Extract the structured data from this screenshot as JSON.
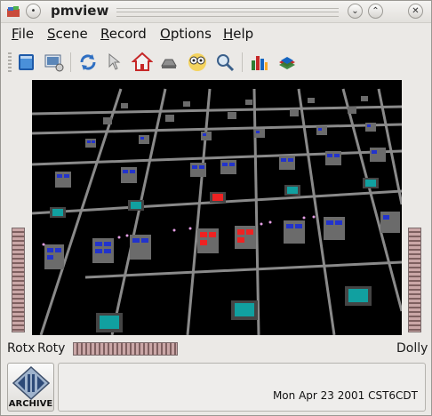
{
  "window": {
    "title": "pmview"
  },
  "titlebar_buttons": {
    "menu_glyph": "•",
    "minimize_glyph": "⌄",
    "maximize_glyph": "⌃",
    "close_glyph": "✕"
  },
  "menu": {
    "items": [
      {
        "accel": "F",
        "rest": "ile"
      },
      {
        "accel": "S",
        "rest": "cene"
      },
      {
        "accel": "R",
        "rest": "ecord"
      },
      {
        "accel": "O",
        "rest": "ptions"
      },
      {
        "accel": "H",
        "rest": "elp"
      }
    ]
  },
  "toolbar": {
    "icons": [
      "open-icon",
      "camera-view-icon",
      "refresh-icon",
      "pointer-icon",
      "home-icon",
      "set-home-icon",
      "view-all-icon",
      "seek-icon",
      "chart-icon",
      "books-icon"
    ]
  },
  "scene": {
    "background": "#000000",
    "component_colors": {
      "base": "#6b6b6b",
      "blue_bar": "#2233cc",
      "red_bar": "#ee2222",
      "teal_block": "#11a0a0",
      "track": "#8a8a8a"
    }
  },
  "controls": {
    "rotx_label": "Rotx",
    "roty_label": "Roty",
    "dolly_label": "Dolly"
  },
  "archive": {
    "label": "ARCHIVE"
  },
  "status": {
    "time": "Mon Apr 23 2001 CST6CDT"
  }
}
